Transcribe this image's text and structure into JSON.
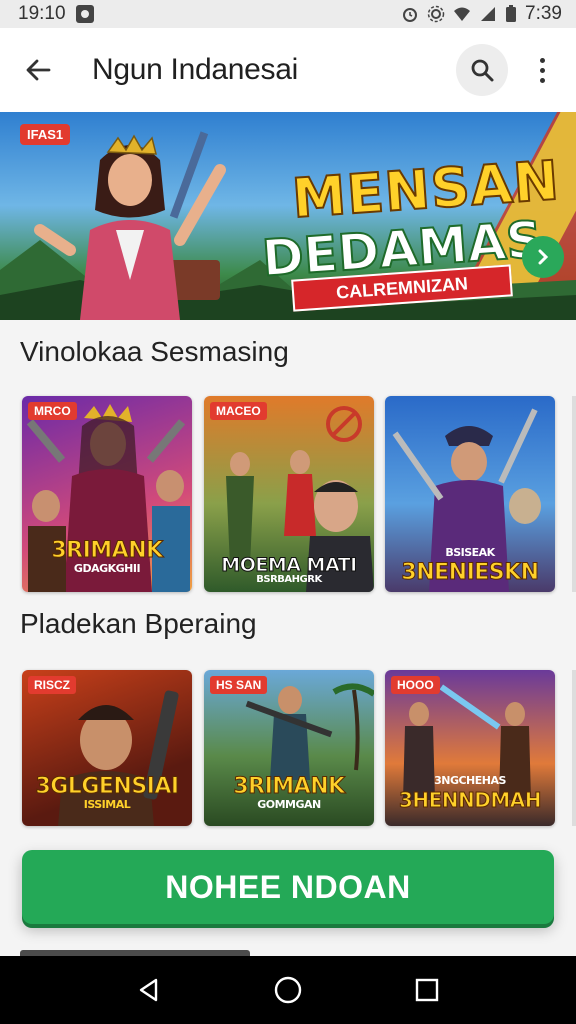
{
  "status_bar": {
    "time_left": "19:10",
    "time_right": "7:39"
  },
  "app_bar": {
    "title": "Ngun Indanesai"
  },
  "hero": {
    "tag": "IFAS1",
    "title_line1": "MENSAN",
    "title_line2": "DEDAMAS",
    "ribbon": "CALREMNIZAN"
  },
  "sections": [
    {
      "title": "Vinolokaa Sesmasing",
      "cards": [
        {
          "tag": "MRCO",
          "caption": "3RIMANK",
          "sub": "GDAGKGHII"
        },
        {
          "tag": "MACEO",
          "caption": "MOEMA MATI",
          "sub": "BSRBAHGRK"
        },
        {
          "tag": "",
          "caption": "3NENIESKN",
          "sub": "BSISEAK"
        }
      ]
    },
    {
      "title": "Pladekan Bperaing",
      "cards": [
        {
          "tag": "RISCZ",
          "caption": "3GLGENSIAI",
          "sub": "ISSIMAL"
        },
        {
          "tag": "HS SAN",
          "caption": "3RIMANK",
          "sub": "GOMMGAN"
        },
        {
          "tag": "HOOO",
          "caption": "3HENNDMAH",
          "sub": "3NGCHEHAS"
        }
      ]
    }
  ],
  "cta": {
    "label": "NOHEE NDOAN"
  },
  "colors": {
    "accent_green": "#24a957",
    "tag_red": "#e23b2f"
  },
  "icons": [
    "back-arrow-icon",
    "search-icon",
    "more-vert-icon",
    "chevron-right-icon",
    "nav-back-icon",
    "nav-home-icon",
    "nav-recents-icon"
  ]
}
